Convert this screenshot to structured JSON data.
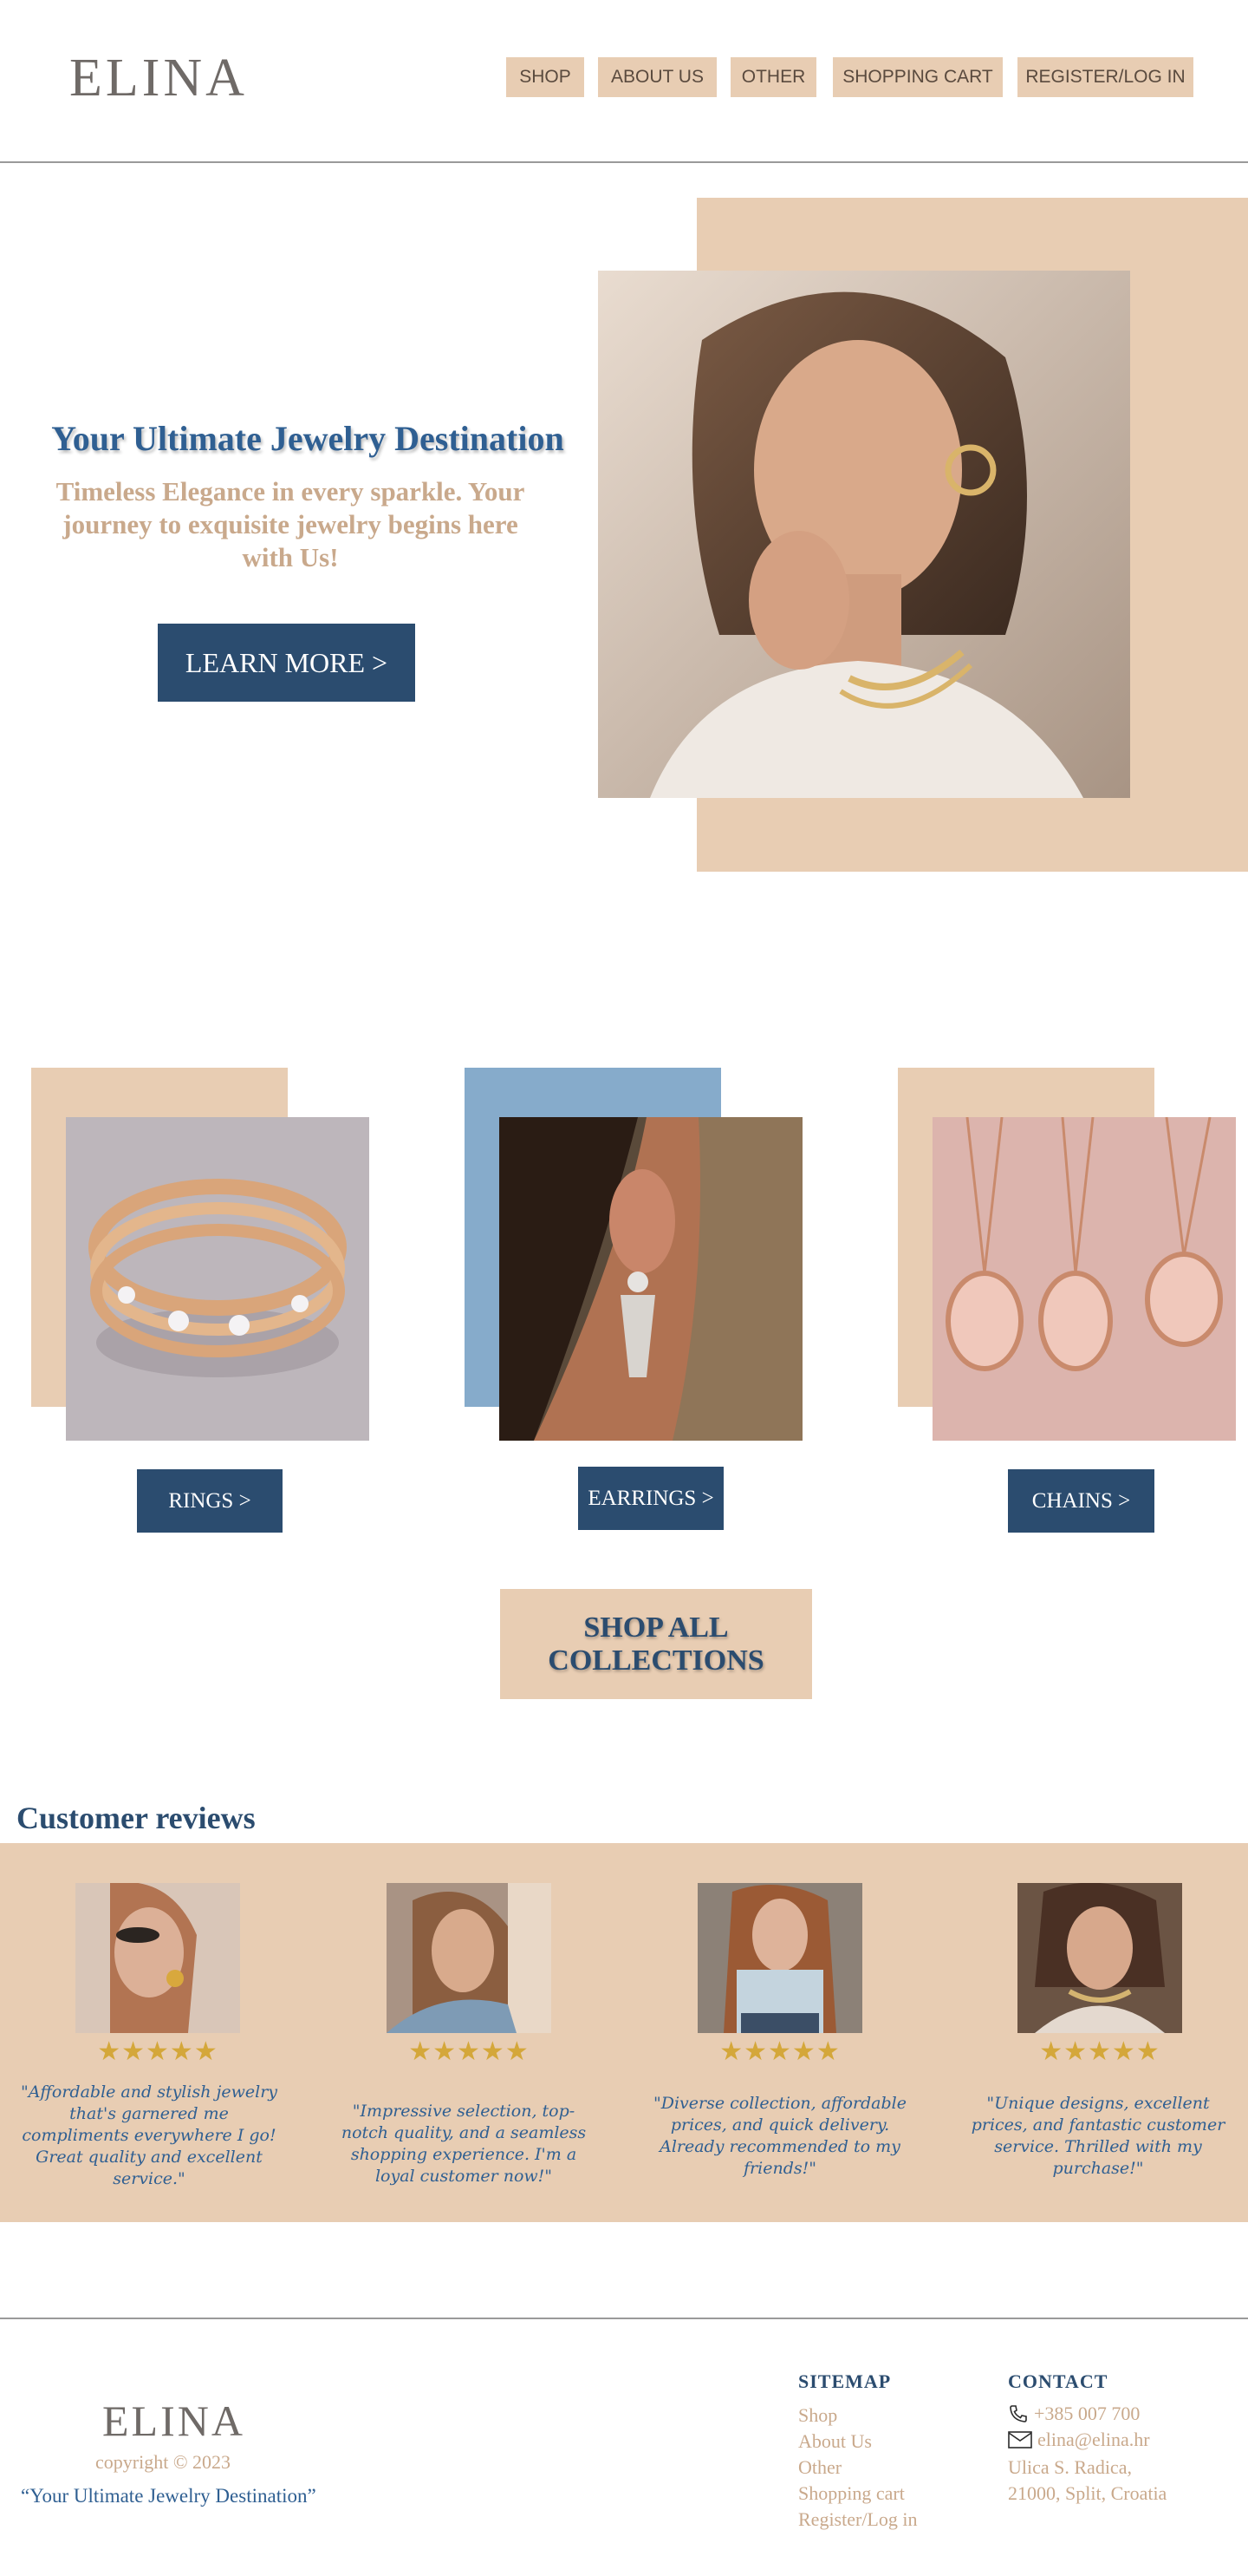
{
  "header": {
    "logo": "ELINA",
    "nav": [
      "SHOP",
      "ABOUT US",
      "OTHER",
      "SHOPPING CART",
      "REGISTER/LOG IN"
    ]
  },
  "hero": {
    "title": "Your Ultimate Jewelry Destination",
    "subtitle": "Timeless Elegance in every sparkle. Your journey to exquisite jewelry begins here with Us!",
    "button": "LEARN MORE >",
    "image_icon": "woman-portrait-photo"
  },
  "collections": {
    "items": [
      {
        "label": "RINGS >",
        "image": "ring-photo",
        "accent": "#e8cdb3"
      },
      {
        "label": "EARRINGS >",
        "image": "earring-photo",
        "accent": "#86abcb"
      },
      {
        "label": "CHAINS >",
        "image": "chain-photo",
        "accent": "#e8cdb3"
      }
    ],
    "shop_all": "SHOP ALL COLLECTIONS"
  },
  "reviews": {
    "title": "Customer reviews",
    "items": [
      {
        "stars": "★★★★★",
        "rating": 5,
        "text": "\"Affordable and stylish jewelry that's garnered me compliments everywhere I go! Great quality and excellent service.\""
      },
      {
        "stars": "★★★★★",
        "rating": 5,
        "text": "\"Impressive selection, top-notch quality, and a seamless shopping experience. I'm a loyal customer now!\""
      },
      {
        "stars": "★★★★★",
        "rating": 5,
        "text": "\"Diverse collection, affordable prices, and quick delivery. Already recommended to my friends!\""
      },
      {
        "stars": "★★★★★",
        "rating": 5,
        "text": "\"Unique designs, excellent prices, and fantastic customer service. Thrilled with my purchase!\""
      }
    ]
  },
  "footer": {
    "logo": "ELINA",
    "copyright": "copyright © 2023",
    "tagline": "“Your Ultimate Jewelry Destination”",
    "sitemap_title": "SITEMAP",
    "sitemap": [
      "Shop",
      "About Us",
      "Other",
      "Shopping cart",
      "Register/Log in"
    ],
    "contact_title": "CONTACT",
    "phone": "+385 007 700",
    "email": "elina@elina.hr",
    "address_line1": "Ulica S. Radica,",
    "address_line2": "21000, Split, Croatia"
  },
  "colors": {
    "accent_beige": "#e8cdb3",
    "navy": "#2b4c6f",
    "blue_title": "#2f5f92",
    "tan_text": "#c9a98c",
    "star_gold": "#d4a73a",
    "sky_blue": "#86abcb"
  }
}
